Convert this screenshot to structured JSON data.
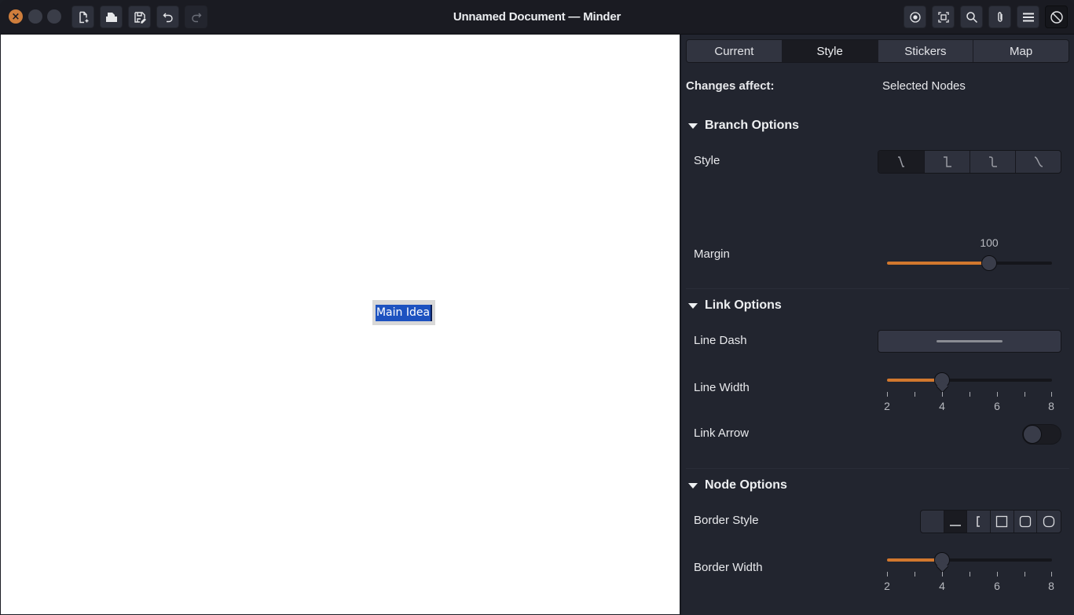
{
  "window": {
    "title": "Unnamed Document — Minder",
    "controls": [
      "close",
      "minimize",
      "maximize"
    ]
  },
  "toolbar": {
    "left": [
      {
        "name": "new-file",
        "icon": "new-file-icon",
        "enabled": true
      },
      {
        "name": "open",
        "icon": "open-folder-icon",
        "enabled": true
      },
      {
        "name": "save-as",
        "icon": "save-as-icon",
        "enabled": true
      },
      {
        "name": "undo",
        "icon": "undo-icon",
        "enabled": true
      },
      {
        "name": "redo",
        "icon": "redo-icon",
        "enabled": false
      }
    ],
    "right": [
      {
        "name": "focus-mode",
        "icon": "target-icon"
      },
      {
        "name": "zoom-fit",
        "icon": "zoom-fit-icon"
      },
      {
        "name": "search",
        "icon": "search-icon"
      },
      {
        "name": "attachments",
        "icon": "paperclip-icon"
      },
      {
        "name": "menu",
        "icon": "hamburger-menu-icon"
      },
      {
        "name": "properties-toggle",
        "icon": "no-entry-icon",
        "active": true
      }
    ]
  },
  "canvas": {
    "node_text": "Main Idea"
  },
  "sidebar": {
    "tabs": [
      {
        "label": "Current",
        "active": false
      },
      {
        "label": "Style",
        "active": true
      },
      {
        "label": "Stickers",
        "active": false
      },
      {
        "label": "Map",
        "active": false
      }
    ],
    "changes_affect": {
      "label": "Changes affect:",
      "value": "Selected Nodes"
    },
    "branch_options": {
      "title": "Branch Options",
      "style_label": "Style",
      "style_options": [
        "straight",
        "squared",
        "rounded",
        "curved"
      ],
      "style_selected": 0,
      "margin_label": "Margin",
      "margin_value": "100",
      "margin_fraction": 0.62
    },
    "link_options": {
      "title": "Link Options",
      "line_dash_label": "Line Dash",
      "line_dash_value": "solid",
      "line_width_label": "Line Width",
      "line_width_value": 4,
      "line_width_ticks": [
        "2",
        "4",
        "6",
        "8"
      ],
      "line_width_range": [
        2,
        8
      ],
      "link_arrow_label": "Link Arrow",
      "link_arrow_on": false
    },
    "node_options": {
      "title": "Node Options",
      "border_style_label": "Border Style",
      "border_style_options": [
        "none",
        "underline",
        "bracket",
        "square",
        "rounded",
        "pill"
      ],
      "border_style_selected": 1,
      "border_width_label": "Border Width",
      "border_width_value": 4,
      "border_width_ticks": [
        "2",
        "4",
        "6",
        "8"
      ],
      "border_width_range": [
        2,
        8
      ]
    }
  },
  "colors": {
    "accent": "#d2782e",
    "close_button": "#cf7e3c",
    "selection": "#1d52c0",
    "sidebar_bg": "#22252f",
    "header_bg": "#1a1b22"
  }
}
